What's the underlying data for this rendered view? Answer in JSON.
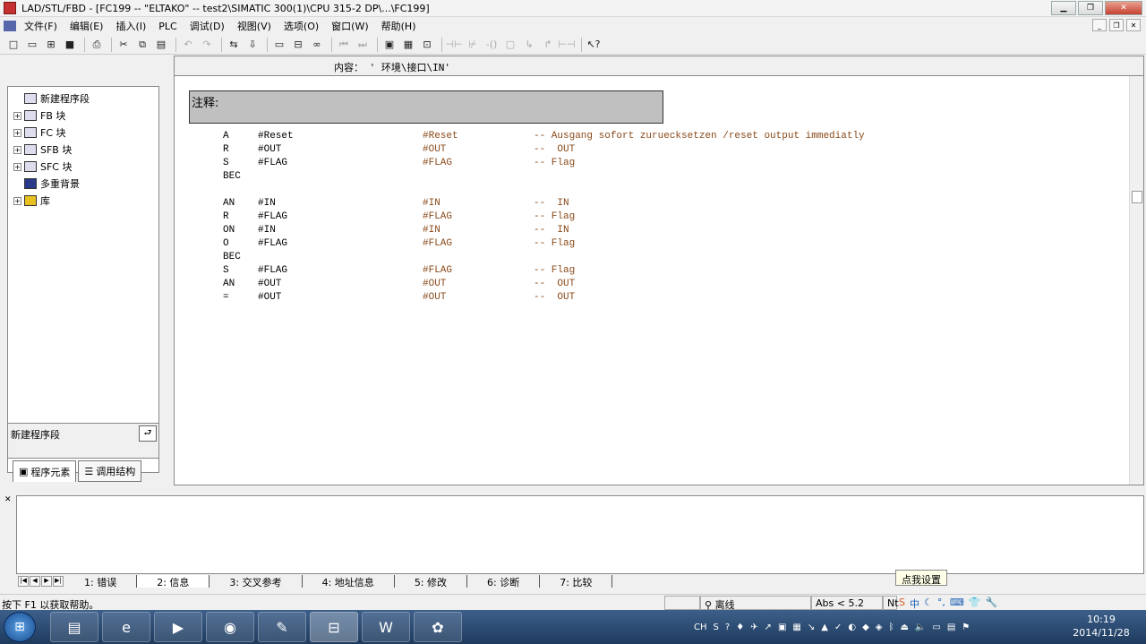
{
  "window": {
    "title": "LAD/STL/FBD  - [FC199 -- \"ELTAKO\" -- test2\\SIMATIC 300(1)\\CPU 315-2 DP\\...\\FC199]"
  },
  "menu": [
    "文件(F)",
    "编辑(E)",
    "插入(I)",
    "PLC",
    "调试(D)",
    "视图(V)",
    "选项(O)",
    "窗口(W)",
    "帮助(H)"
  ],
  "left_panel": {
    "tree": [
      {
        "label": "新建程序段",
        "expander": ""
      },
      {
        "label": "FB 块",
        "expander": "+"
      },
      {
        "label": "FC 块",
        "expander": "+"
      },
      {
        "label": "SFB 块",
        "expander": "+"
      },
      {
        "label": "SFC 块",
        "expander": "+"
      },
      {
        "label": "多重背景",
        "expander": ""
      },
      {
        "label": "库",
        "expander": "+"
      }
    ],
    "info_text": "新建程序段",
    "tabs": [
      "程序元素",
      "调用结构"
    ]
  },
  "editor": {
    "content_label": "内容：  ' 环境\\接口\\IN'",
    "comment_label": "注释:",
    "lines": [
      {
        "op": "A",
        "operand": "#Reset",
        "sym": "#Reset",
        "cmt": "-- Ausgang sofort zuruecksetzen /reset output immediatly"
      },
      {
        "op": "R",
        "operand": "#OUT",
        "sym": "#OUT",
        "cmt": "--  OUT"
      },
      {
        "op": "S",
        "operand": "#FLAG",
        "sym": "#FLAG",
        "cmt": "-- Flag"
      },
      {
        "op": "BEC",
        "operand": "",
        "sym": "",
        "cmt": ""
      },
      {
        "op": "",
        "operand": "",
        "sym": "",
        "cmt": ""
      },
      {
        "op": "AN",
        "operand": "#IN",
        "sym": "#IN",
        "cmt": "--  IN"
      },
      {
        "op": "R",
        "operand": "#FLAG",
        "sym": "#FLAG",
        "cmt": "-- Flag"
      },
      {
        "op": "ON",
        "operand": "#IN",
        "sym": "#IN",
        "cmt": "--  IN"
      },
      {
        "op": "O",
        "operand": "#FLAG",
        "sym": "#FLAG",
        "cmt": "-- Flag"
      },
      {
        "op": "BEC",
        "operand": "",
        "sym": "",
        "cmt": ""
      },
      {
        "op": "S",
        "operand": "#FLAG",
        "sym": "#FLAG",
        "cmt": "-- Flag"
      },
      {
        "op": "AN",
        "operand": "#OUT",
        "sym": "#OUT",
        "cmt": "--  OUT"
      },
      {
        "op": "=",
        "operand": "#OUT",
        "sym": "#OUT",
        "cmt": "--  OUT"
      }
    ]
  },
  "bottom_tabs": [
    "1: 错误",
    "2: 信息",
    "3: 交叉参考",
    "4: 地址信息",
    "5: 修改",
    "6: 诊断",
    "7: 比较"
  ],
  "tooltip": "点我设置",
  "status": {
    "help": "按下 F1 以获取帮助。",
    "online": "离线",
    "abs": "Abs < 5.2",
    "mode": "Nt"
  },
  "taskbar": {
    "tray_lang": "CH",
    "time": "10:19",
    "date": "2014/11/28"
  }
}
